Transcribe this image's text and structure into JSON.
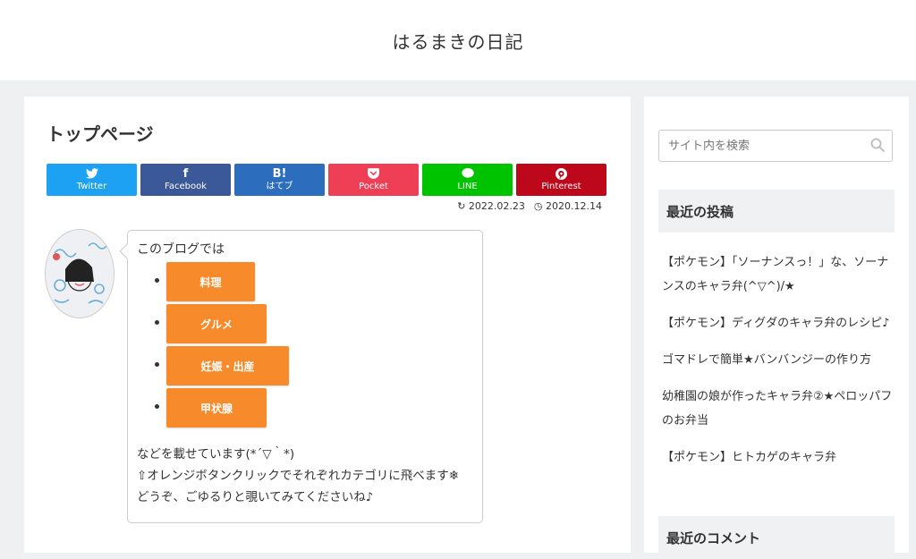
{
  "header": {
    "site_title": "はるまきの日記"
  },
  "main": {
    "page_title": "トップページ",
    "share_buttons": [
      {
        "label": "Twitter",
        "icon": "twitter-icon",
        "glyph": "🐦",
        "color": "#1da1f2"
      },
      {
        "label": "Facebook",
        "icon": "facebook-icon",
        "glyph": "f",
        "color": "#3b5998"
      },
      {
        "label": "はてブ",
        "icon": "hatena-icon",
        "glyph": "B!",
        "color": "#2c6ebd"
      },
      {
        "label": "Pocket",
        "icon": "pocket-icon",
        "glyph": "⬡",
        "color": "#ef3f56"
      },
      {
        "label": "LINE",
        "icon": "line-icon",
        "glyph": "◯",
        "color": "#00c300"
      },
      {
        "label": "Pinterest",
        "icon": "pinterest-icon",
        "glyph": "℗",
        "color": "#bd081c"
      }
    ],
    "dates": {
      "updated": "2022.02.23",
      "published": "2020.12.14"
    },
    "bubble": {
      "intro": "このブログでは",
      "categories": [
        "料理",
        "グルメ",
        "妊娠・出産",
        "甲状腺"
      ],
      "lines": [
        "などを載せています(*´▽｀*)",
        "⇧オレンジボタンクリックでそれぞれカテゴリに飛べます❄",
        "どうぞ、ごゆるりと覗いてみてくださいね♪"
      ],
      "button_color": "#f78b2b"
    }
  },
  "sidebar": {
    "search_placeholder": "サイト内を検索",
    "recent_posts_title": "最近の投稿",
    "recent_posts": [
      "【ポケモン】「ソーナンスっ！」な、ソーナンスのキャラ弁(^▽^)/★",
      "【ポケモン】ディグダのキャラ弁のレシピ♪",
      "ゴマドレで簡単★バンバンジーの作り方",
      "幼稚園の娘が作ったキャラ弁②★ペロッパフのお弁当",
      "【ポケモン】ヒトカゲのキャラ弁"
    ],
    "recent_comments_title": "最近のコメント"
  }
}
